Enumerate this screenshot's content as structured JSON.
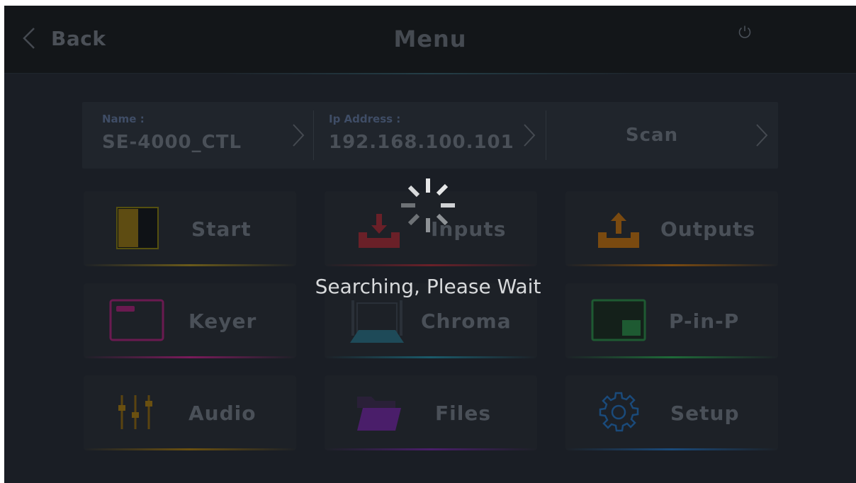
{
  "header": {
    "back_label": "Back",
    "title": "Menu",
    "back_icon": "chevron-left-icon",
    "power_icon": "power-icon"
  },
  "info_bar": {
    "name_caption": "Name :",
    "name_value": "SE-4000_CTL",
    "ip_caption": "Ip Address :",
    "ip_value": "192.168.100.101",
    "scan_label": "Scan"
  },
  "tiles": [
    {
      "label": "Start",
      "icon": "start-panel-icon",
      "accent": "#6a5a1a"
    },
    {
      "label": "Inputs",
      "icon": "download-tray-icon",
      "accent": "#6a2028"
    },
    {
      "label": "Outputs",
      "icon": "upload-tray-icon",
      "accent": "#7a4a10"
    },
    {
      "label": "Keyer",
      "icon": "keyer-window-icon",
      "accent": "#7a1a5a"
    },
    {
      "label": "Chroma",
      "icon": "chroma-screen-icon",
      "accent": "#1a5a6a"
    },
    {
      "label": "P-in-P",
      "icon": "picture-in-picture-icon",
      "accent": "#1e6a38"
    },
    {
      "label": "Audio",
      "icon": "audio-faders-icon",
      "accent": "#6a5010"
    },
    {
      "label": "Files",
      "icon": "folder-icon",
      "accent": "#4a1e6a"
    },
    {
      "label": "Setup",
      "icon": "gear-icon",
      "accent": "#1a4a7a"
    }
  ],
  "overlay": {
    "message": "Searching, Please Wait",
    "spinner_icon": "loading-spinner-icon"
  }
}
